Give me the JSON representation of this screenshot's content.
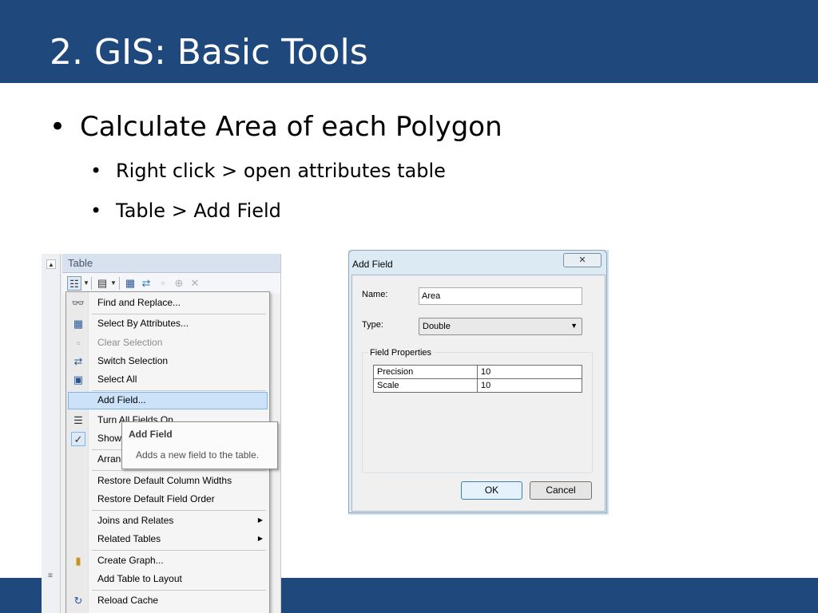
{
  "slide": {
    "title": "2. GIS: Basic Tools",
    "bullets": [
      {
        "text": "Calculate Area of each Polygon",
        "sub": [
          "Right click > open attributes table",
          "Table > Add Field"
        ]
      }
    ]
  },
  "menu_screenshot": {
    "header_label": "Table",
    "toolbar_icons": [
      "table-options-icon",
      "related-tables-icon",
      "select-by-attributes-icon",
      "switch-selection-icon",
      "clear-selection-icon",
      "zoom-to-selected-icon",
      "delete-icon"
    ],
    "menu_items": [
      {
        "label": "Find and Replace...",
        "icon": "binoculars-icon",
        "enabled": true
      },
      {
        "label": "Select By Attributes...",
        "icon": "select-by-attributes-icon",
        "enabled": true
      },
      {
        "label": "Clear Selection",
        "icon": "clear-selection-icon",
        "enabled": false
      },
      {
        "label": "Switch Selection",
        "icon": "switch-selection-icon",
        "enabled": true
      },
      {
        "label": "Select All",
        "icon": "select-all-icon",
        "enabled": true
      },
      {
        "label": "Add Field...",
        "icon": "",
        "enabled": true,
        "highlighted": true
      },
      {
        "label": "Turn All Fields On",
        "icon": "fields-icon",
        "enabled": true
      },
      {
        "label": "Show Field Aliases",
        "icon": "check-icon",
        "enabled": true,
        "checked": true
      },
      {
        "label": "Arrange Tables",
        "icon": "",
        "enabled": true
      },
      {
        "label": "Restore Default Column Widths",
        "icon": "",
        "enabled": true
      },
      {
        "label": "Restore Default Field Order",
        "icon": "",
        "enabled": true
      },
      {
        "label": "Joins and Relates",
        "icon": "",
        "enabled": true,
        "submenu": true
      },
      {
        "label": "Related Tables",
        "icon": "",
        "enabled": true,
        "submenu": true
      },
      {
        "label": "Create Graph...",
        "icon": "graph-icon",
        "enabled": true
      },
      {
        "label": "Add Table to Layout",
        "icon": "",
        "enabled": true
      },
      {
        "label": "Reload Cache",
        "icon": "reload-icon",
        "enabled": true
      }
    ],
    "tooltip": {
      "title": "Add Field",
      "body": "Adds a new field to the table."
    }
  },
  "add_field_dialog": {
    "title": "Add Field",
    "close_glyph": "✕",
    "name_label": "Name:",
    "name_value": "Area",
    "type_label": "Type:",
    "type_value": "Double",
    "group_label": "Field Properties",
    "properties": [
      {
        "key": "Precision",
        "value": "10"
      },
      {
        "key": "Scale",
        "value": "10"
      }
    ],
    "ok_label": "OK",
    "cancel_label": "Cancel"
  }
}
